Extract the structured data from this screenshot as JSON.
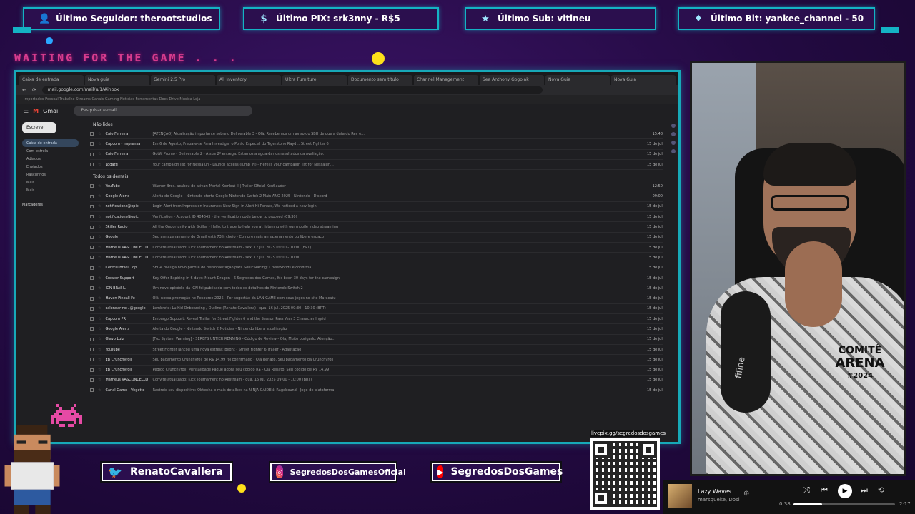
{
  "alerts": {
    "follower": "Último Seguidor: therootstudios",
    "pix": "Último PIX: srk3nny - R$5",
    "sub": "Último Sub: vitineu",
    "bit": "Último Bit: yankee_channel - 50"
  },
  "waiting_text": "WAITING FOR THE GAME . . .",
  "browser": {
    "tabs": [
      "Caixa de entrada",
      "Nova guia",
      "Gemini 2.5 Pro",
      "All Inventory",
      "Ultra Furniture",
      "Documento sem título",
      "Channel Management",
      "Sea Anthony Gogolak",
      "Nova Guia",
      "Nova Guia"
    ],
    "url": "mail.google.com/mail/u/1/#inbox",
    "bookmarks": "Importados   Pessoal   Trabalho   Streams   Canais   Gaming   Notícias   Ferramentas   Docs   Drive   Música   Loja"
  },
  "gmail": {
    "logo": "Gmail",
    "search_placeholder": "Pesquisar e-mail",
    "compose": "Escrever",
    "sidebar": [
      "Caixa de entrada",
      "Com estrela",
      "Adiados",
      "Enviados",
      "Rascunhos",
      "Mais",
      "Mais"
    ],
    "labels_title": "Marcadores",
    "section_unread": "Não lidos",
    "section_all": "Todos os demais",
    "unread_rows": [
      {
        "sender": "Caio Ferreira",
        "subject": "[ATENÇÃO] Atualização importante sobre o Deliverable 3 - Olá, Recebemos um aviso do SBH de que a data do Rev é...",
        "date": "15:48"
      },
      {
        "sender": "Capcom - Imprensa",
        "subject": "Em 6 de Agosto, Prepare-se Para Investigar o Porão Especial do Tigerstone Rayd... Street Fighter 6",
        "date": "15 de jul."
      },
      {
        "sender": "Caio Ferreira",
        "subject": "GotW Promo - Deliverable 2 - A sua 2ª entrega. Estamos a aguardar os resultados da avaliação.",
        "date": "15 de jul."
      },
      {
        "sender": "Lodatti",
        "subject": "Your campaign list for Nessaluh - Launch access (Jump IN) - Here is your campaign list for Nessaluh...",
        "date": "15 de jul."
      }
    ],
    "all_rows": [
      {
        "sender": "YouTube",
        "subject": "Warner Bros. acabou de ativar: Mortal Kombat II | Trailer Oficial Koutlauder",
        "date": "12:50"
      },
      {
        "sender": "Google Alerts",
        "subject": "Alerta do Google - Nintendo oferta Google Nintendo Switch 2 Mais ANO 2025 | Nintendo | Discord",
        "date": "09:00"
      },
      {
        "sender": "notifications@epic",
        "subject": "Login Alert from Impression Insurance: New Sign-in Alert Hi Renato, We noticed a new login",
        "date": "15 de jul."
      },
      {
        "sender": "notifications@epic",
        "subject": "Verification - Account ID 404643 - the verification code below to proceed (09:30)",
        "date": "15 de jul."
      },
      {
        "sender": "Skiller Radio",
        "subject": "All the Opportunity with Skiller - Hello, to trade to help you at listening with our mobile video streaming",
        "date": "15 de jul."
      },
      {
        "sender": "Google",
        "subject": "Seu armazenamento do Gmail está 73% cheio - Compre mais armazenamento ou libere espaço",
        "date": "15 de jul."
      },
      {
        "sender": "Matheus VASCONCELLOS",
        "subject": "Convite atualizado: Kick Tournament no Restream - sex. 17 jul. 2025 09:00 - 10:00 (BRT)",
        "date": "15 de jul."
      },
      {
        "sender": "Matheus VASCONCELLOS",
        "subject": "Convite atualizado: Kick Tournament no Restream - sex. 17 jul. 2025 09:00 - 10:00",
        "date": "15 de jul."
      },
      {
        "sender": "Central Brasil Top",
        "subject": "SEGA divulga novo pacote de personalização para Sonic Racing: CrossWorlds e confirma...",
        "date": "15 de jul."
      },
      {
        "sender": "Creator Support",
        "subject": "Key Offer Expiring in 6 days: Mount Dragon - 6 Segredos dos Games, It's been 30 days for the campaign",
        "date": "15 de jul."
      },
      {
        "sender": "IGN BRASIL",
        "subject": "Um novo episódio da IGN foi publicado com todos os detalhes do Nintendo Switch 2",
        "date": "15 de jul."
      },
      {
        "sender": "Haven Pinball Fe",
        "subject": "Olá, nossa promoção no Resource 2025 - Por sugestão da LAN GAME com seus jogos no site Maracatu",
        "date": "15 de jul."
      },
      {
        "sender": "calendar-no...@google",
        "subject": "Lembrete: Lu Kid Onboarding / Outline (Renato Cavallera) - qua. 16 jul. 2025 09:30 - 10:30 (BRT)",
        "date": "15 de jul."
      },
      {
        "sender": "Capcom PR",
        "subject": "Embargo Support: Reveal Trailer for Street Fighter 6 and the Season Pass Year 3 Character Ingrid",
        "date": "15 de jul."
      },
      {
        "sender": "Google Alerts",
        "subject": "Alerta do Google - Nintendo Switch 2 Notícias - Nintendo libera atualização",
        "date": "15 de jul."
      },
      {
        "sender": "Olavo Luiz",
        "subject": "[Fox System Warning] - SEREFS UNTIER RENNING - Código de Review - Olá, Muito obrigado. Atenção...",
        "date": "15 de jul."
      },
      {
        "sender": "YouTube",
        "subject": "Street Fighter lançou uma nova estreia: Blight - Street Fighter 6 Trailer - Adaptação",
        "date": "15 de jul."
      },
      {
        "sender": "EB Crunchyroll",
        "subject": "Seu pagamento Crunchyroll de R$ 14,99 foi confirmado - Olá Renato, Seu pagamento da Crunchyroll",
        "date": "15 de jul."
      },
      {
        "sender": "EB Crunchyroll",
        "subject": "Pedido Crunchyroll: Mensalidade Pague agora seu código R$ - Olá Renato, Seu código de R$ 14,99",
        "date": "15 de jul."
      },
      {
        "sender": "Matheus VASCONCELLOS",
        "subject": "Convite atualizado: Kick Tournament no Restream - qua. 16 jul. 2025 09:00 - 10:00 (BRT)",
        "date": "15 de jul."
      },
      {
        "sender": "Canal Game - Vegetto",
        "subject": "Rastreie seu dispositivo: Obtenha o mais detalhes na NINJA GAIDEN: Ragebound - Jogo de plataforma",
        "date": "15 de jul."
      }
    ]
  },
  "webcam": {
    "mic_label": "fifine",
    "shirt_badge_line1": "COMITÊ",
    "shirt_badge_line2": "ARENA",
    "shirt_badge_line3": "#2024"
  },
  "socials": {
    "twitter": "RenatoCavallera",
    "instagram": "SegredosDosGamesOficial",
    "youtube": "SegredosDosGames"
  },
  "qr": {
    "label": "livepix.gg/segredosdosgames"
  },
  "player": {
    "track": "Lazy Waves",
    "artist": "marsqueke, Dosi",
    "time_current": "0:38",
    "time_total": "2:17",
    "progress": 0.28
  },
  "colors": {
    "frame_accent": "#14b3c4",
    "overlay_bg": "#2b0f4e",
    "waiting_text": "#d63c8e"
  }
}
